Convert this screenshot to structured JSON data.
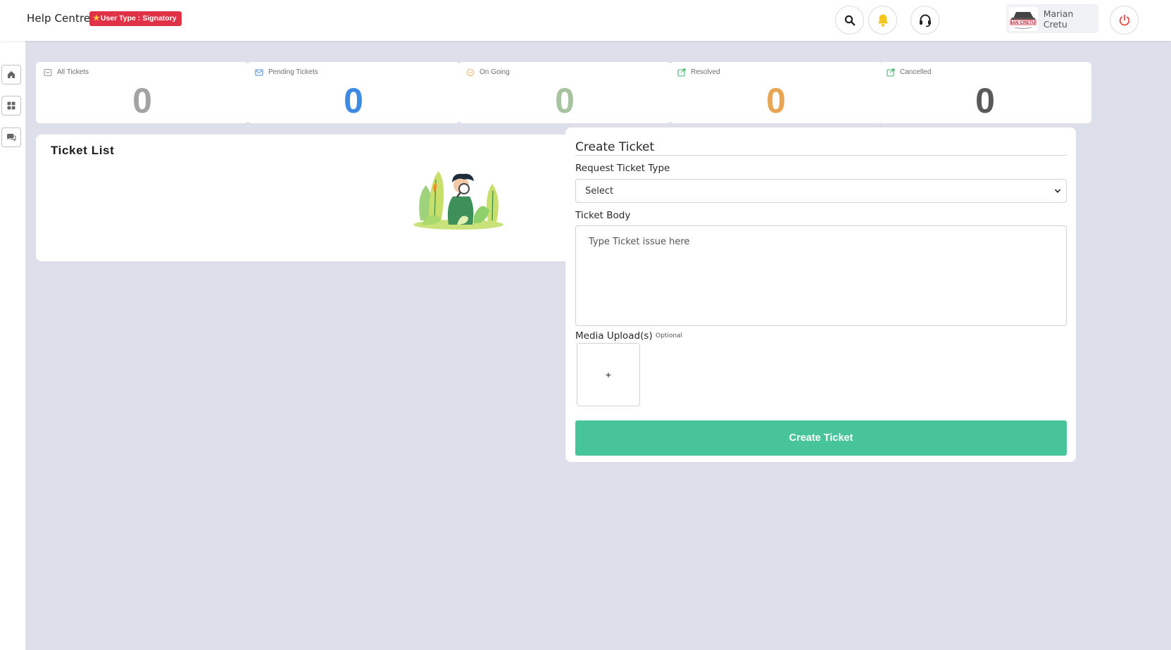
{
  "header": {
    "title": "Help Centre",
    "badge": "User Type : Signatory",
    "user_name": "Marian Cretu",
    "avatar_logo_text": "IAN CRETU"
  },
  "stats": [
    {
      "label": "All Tickets",
      "value": "0",
      "color": "#a3a3a3",
      "icon_color": "#9a9a9a"
    },
    {
      "label": "Pending Tickets",
      "value": "0",
      "color": "#3d8ae6",
      "icon_color": "#4a90e2"
    },
    {
      "label": "On Going",
      "value": "0",
      "color": "#a8c3a0",
      "icon_color": "#f0b070"
    },
    {
      "label": "Resolved",
      "value": "0",
      "color": "#e8a553",
      "icon_color": "#45b96c"
    },
    {
      "label": "Cancelled",
      "value": "0",
      "color": "#5a5a5a",
      "icon_color": "#45b96c"
    }
  ],
  "ticket_list": {
    "title": "Ticket List"
  },
  "create_ticket": {
    "title": "Create Ticket",
    "type_label": "Request Ticket Type",
    "type_value": "Select",
    "body_label": "Ticket Body",
    "body_placeholder": "Type Ticket issue here",
    "media_label": "Media Upload(s)",
    "optional_label": "Optional",
    "upload_plus": "+",
    "submit_label": "Create Ticket"
  },
  "colors": {
    "accent_green": "#47c49a",
    "badge_red": "#e03246",
    "bell_yellow": "#f5c518",
    "power_red": "#e53935",
    "background": "#dde0ea"
  },
  "icons": [
    "star-icon",
    "search-icon",
    "bell-icon",
    "headset-icon",
    "power-icon",
    "home-icon",
    "grid-icon",
    "chat-icon",
    "chevron-down-icon"
  ]
}
